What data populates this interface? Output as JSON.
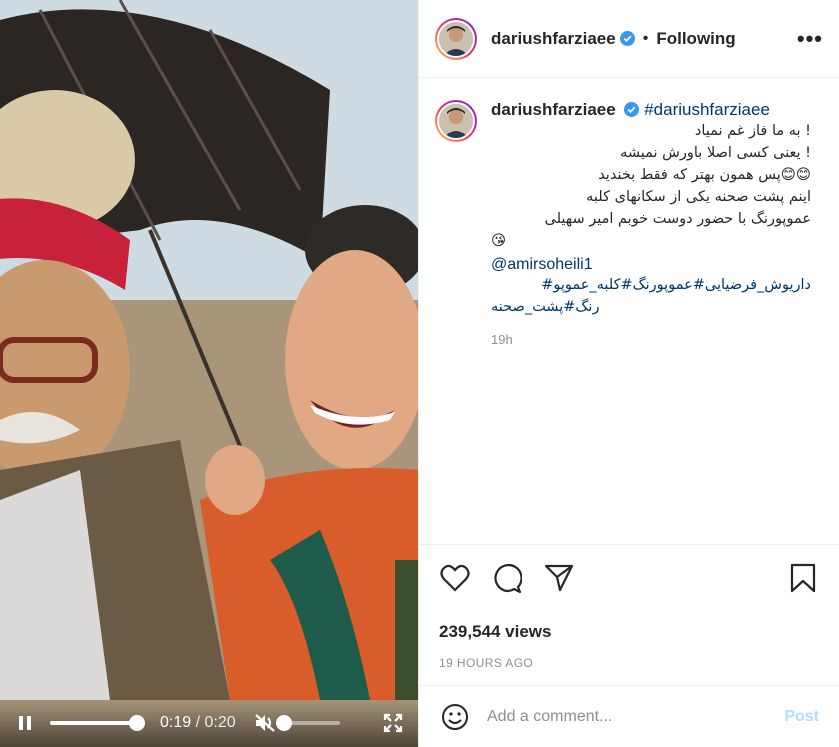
{
  "header": {
    "username": "dariushfarziaee",
    "separator": "•",
    "follow_status": "Following",
    "more_label": "•••"
  },
  "caption": {
    "username": "dariushfarziaee",
    "hashtag": "#dariushfarziaee",
    "lines": [
      "! به ما فاز غم نمیاد",
      "! یعنی کسی اصلا باورش نمیشه",
      "😊😊پس همون بهتر که فقط بخندید",
      "اینم پشت صحنه یکی از سکانهای کلبه",
      "عموپورنگ با حضور دوست خوبم امیر سهیلی",
      "😘"
    ],
    "mention": "@amirsoheili1",
    "tags_lines": [
      "داریوش_فرضیایی#عموپورنگ#کلبه_عموپو#",
      "رنگ#پشت_صحنه"
    ],
    "time_ago": "19h"
  },
  "stats": {
    "views": "239,544 views",
    "posted": "19 HOURS AGO"
  },
  "comment": {
    "placeholder": "Add a comment...",
    "post_label": "Post"
  },
  "video": {
    "current_time": "0:19",
    "separator": "/",
    "duration": "0:20",
    "progress": 0.95,
    "volume": 0.0
  },
  "colors": {
    "link": "#00376b",
    "muted": "#8e8e8e",
    "post_disabled": "#b2dffc",
    "verified": "#3897f0"
  },
  "icons": [
    "verified-badge-icon",
    "more-icon",
    "heart-icon",
    "comment-icon",
    "share-icon",
    "bookmark-icon",
    "emoji-icon",
    "pause-icon",
    "mute-icon",
    "fullscreen-icon"
  ]
}
